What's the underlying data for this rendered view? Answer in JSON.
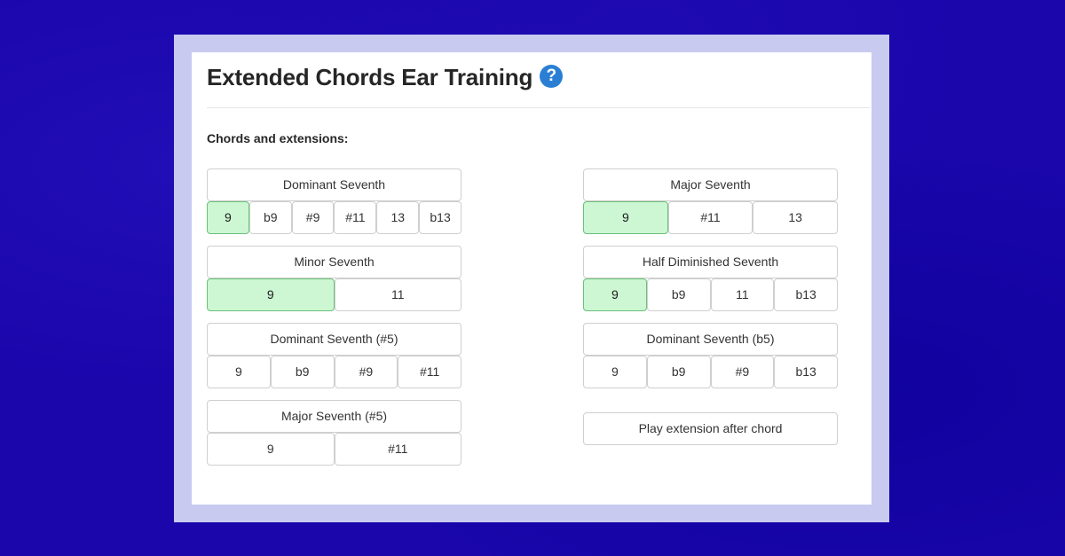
{
  "title": "Extended Chords Ear Training",
  "help_icon": "question-circle-icon",
  "section_label": "Chords and extensions:",
  "accent_color": "#ccf7d2",
  "groups": [
    {
      "chord": "Dominant Seventh",
      "extensions": [
        {
          "label": "9",
          "selected": true
        },
        {
          "label": "b9",
          "selected": false
        },
        {
          "label": "#9",
          "selected": false
        },
        {
          "label": "#11",
          "selected": false
        },
        {
          "label": "13",
          "selected": false
        },
        {
          "label": "b13",
          "selected": false
        }
      ]
    },
    {
      "chord": "Major Seventh",
      "extensions": [
        {
          "label": "9",
          "selected": true
        },
        {
          "label": "#11",
          "selected": false
        },
        {
          "label": "13",
          "selected": false
        }
      ]
    },
    {
      "chord": "Minor Seventh",
      "extensions": [
        {
          "label": "9",
          "selected": true
        },
        {
          "label": "11",
          "selected": false
        }
      ]
    },
    {
      "chord": "Half Diminished Seventh",
      "extensions": [
        {
          "label": "9",
          "selected": true
        },
        {
          "label": "b9",
          "selected": false
        },
        {
          "label": "11",
          "selected": false
        },
        {
          "label": "b13",
          "selected": false
        }
      ]
    },
    {
      "chord": "Dominant Seventh (#5)",
      "extensions": [
        {
          "label": "9",
          "selected": false
        },
        {
          "label": "b9",
          "selected": false
        },
        {
          "label": "#9",
          "selected": false
        },
        {
          "label": "#11",
          "selected": false
        }
      ]
    },
    {
      "chord": "Dominant Seventh (b5)",
      "extensions": [
        {
          "label": "9",
          "selected": false
        },
        {
          "label": "b9",
          "selected": false
        },
        {
          "label": "#9",
          "selected": false
        },
        {
          "label": "b13",
          "selected": false
        }
      ]
    },
    {
      "chord": "Major Seventh (#5)",
      "extensions": [
        {
          "label": "9",
          "selected": false
        },
        {
          "label": "#11",
          "selected": false
        }
      ]
    }
  ],
  "play_extension_label": "Play extension after chord"
}
